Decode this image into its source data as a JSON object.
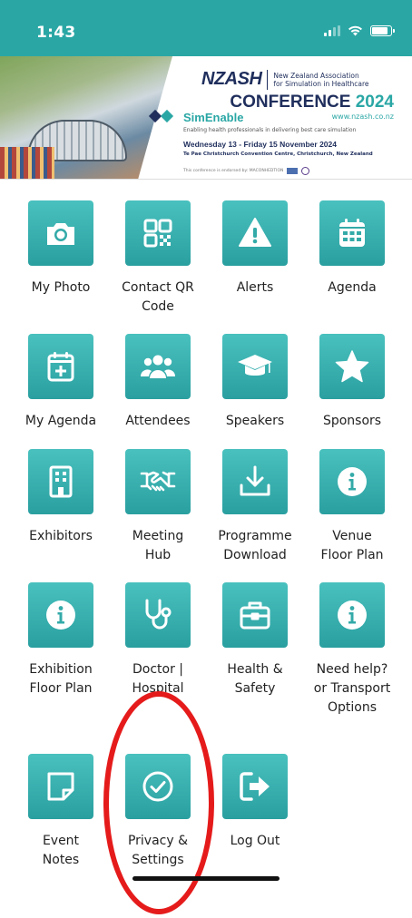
{
  "status_bar": {
    "time": "1:43"
  },
  "banner": {
    "logo": "NZASH",
    "org_name_line1": "New Zealand Association",
    "org_name_line2": "for Simulation in Healthcare",
    "conference": "CONFERENCE",
    "year": "2024",
    "url": "www.nzash.co.nz",
    "theme": "SimEnable",
    "tagline": "Enabling health professionals in delivering best care simulation",
    "dates": "Wednesday 13 - Friday 15 November 2024",
    "venue": "Te Pae Christchurch Convention Centre, Christchurch, New Zealand",
    "endorsement": "This conference is endorsed by: MACONHEDTION"
  },
  "menu": [
    {
      "label": "My Photo",
      "icon": "camera-icon"
    },
    {
      "label": "Contact QR Code",
      "icon": "qr-code-icon"
    },
    {
      "label": "Alerts",
      "icon": "warning-icon"
    },
    {
      "label": "Agenda",
      "icon": "calendar-icon"
    },
    {
      "label": "My Agenda",
      "icon": "calendar-plus-icon"
    },
    {
      "label": "Attendees",
      "icon": "users-icon"
    },
    {
      "label": "Speakers",
      "icon": "graduation-cap-icon"
    },
    {
      "label": "Sponsors",
      "icon": "star-icon"
    },
    {
      "label": "Exhibitors",
      "icon": "building-icon"
    },
    {
      "label": "Meeting Hub",
      "icon": "handshake-icon"
    },
    {
      "label": "Programme Download",
      "icon": "download-icon"
    },
    {
      "label": "Venue Floor Plan",
      "icon": "info-icon"
    },
    {
      "label": "Exhibition Floor Plan",
      "icon": "info-icon"
    },
    {
      "label": "Doctor | Hospital",
      "icon": "stethoscope-icon"
    },
    {
      "label": "Health & Safety",
      "icon": "first-aid-kit-icon"
    },
    {
      "label": "Need help? or Transport Options",
      "icon": "info-icon"
    },
    {
      "label": "Event Notes",
      "icon": "sticky-note-icon"
    },
    {
      "label": "Privacy & Settings",
      "icon": "check-circle-icon"
    },
    {
      "label": "Log Out",
      "icon": "logout-icon"
    }
  ],
  "colors": {
    "accent": "#2aa7a5",
    "tile_top": "#49c1be",
    "highlight": "#e51b1b",
    "brand_navy": "#1f2e5c"
  }
}
